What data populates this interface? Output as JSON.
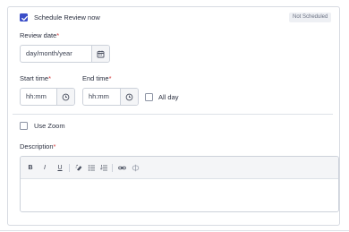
{
  "schedule": {
    "label": "Schedule Review now",
    "checked": true,
    "status_badge": "Not Scheduled"
  },
  "review_date": {
    "label": "Review date",
    "required_mark": "*",
    "placeholder": "day/month/year"
  },
  "start_time": {
    "label": "Start time",
    "required_mark": "*",
    "placeholder": "hh:mm"
  },
  "end_time": {
    "label": "End time",
    "required_mark": "*",
    "placeholder": "hh:mm"
  },
  "all_day": {
    "label": "All day",
    "checked": false
  },
  "use_zoom": {
    "label": "Use Zoom",
    "checked": false
  },
  "description": {
    "label": "Description",
    "required_mark": "*",
    "toolbar": {
      "bold": "B",
      "italic": "I",
      "underline": "U",
      "icons": [
        "clear-format-icon",
        "bullet-list-icon",
        "numbered-list-icon",
        "link-icon",
        "unlink-icon"
      ]
    },
    "value": ""
  }
}
